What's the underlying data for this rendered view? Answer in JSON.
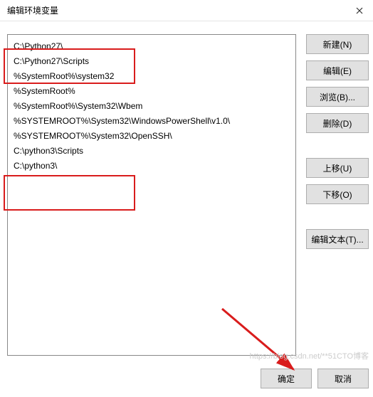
{
  "window": {
    "title": "编辑环境变量"
  },
  "list": {
    "items": [
      "C:\\Python27\\",
      "C:\\Python27\\Scripts",
      "%SystemRoot%\\system32",
      "%SystemRoot%",
      "%SystemRoot%\\System32\\Wbem",
      "%SYSTEMROOT%\\System32\\WindowsPowerShell\\v1.0\\",
      "%SYSTEMROOT%\\System32\\OpenSSH\\",
      "C:\\python3\\Scripts",
      "C:\\python3\\"
    ]
  },
  "buttons": {
    "new": "新建(N)",
    "edit": "编辑(E)",
    "browse": "浏览(B)...",
    "delete": "删除(D)",
    "moveup": "上移(U)",
    "movedown": "下移(O)",
    "edittext": "编辑文本(T)...",
    "ok": "确定",
    "cancel": "取消"
  },
  "watermark": "https://blog.csdn.net/**51CTO博客"
}
